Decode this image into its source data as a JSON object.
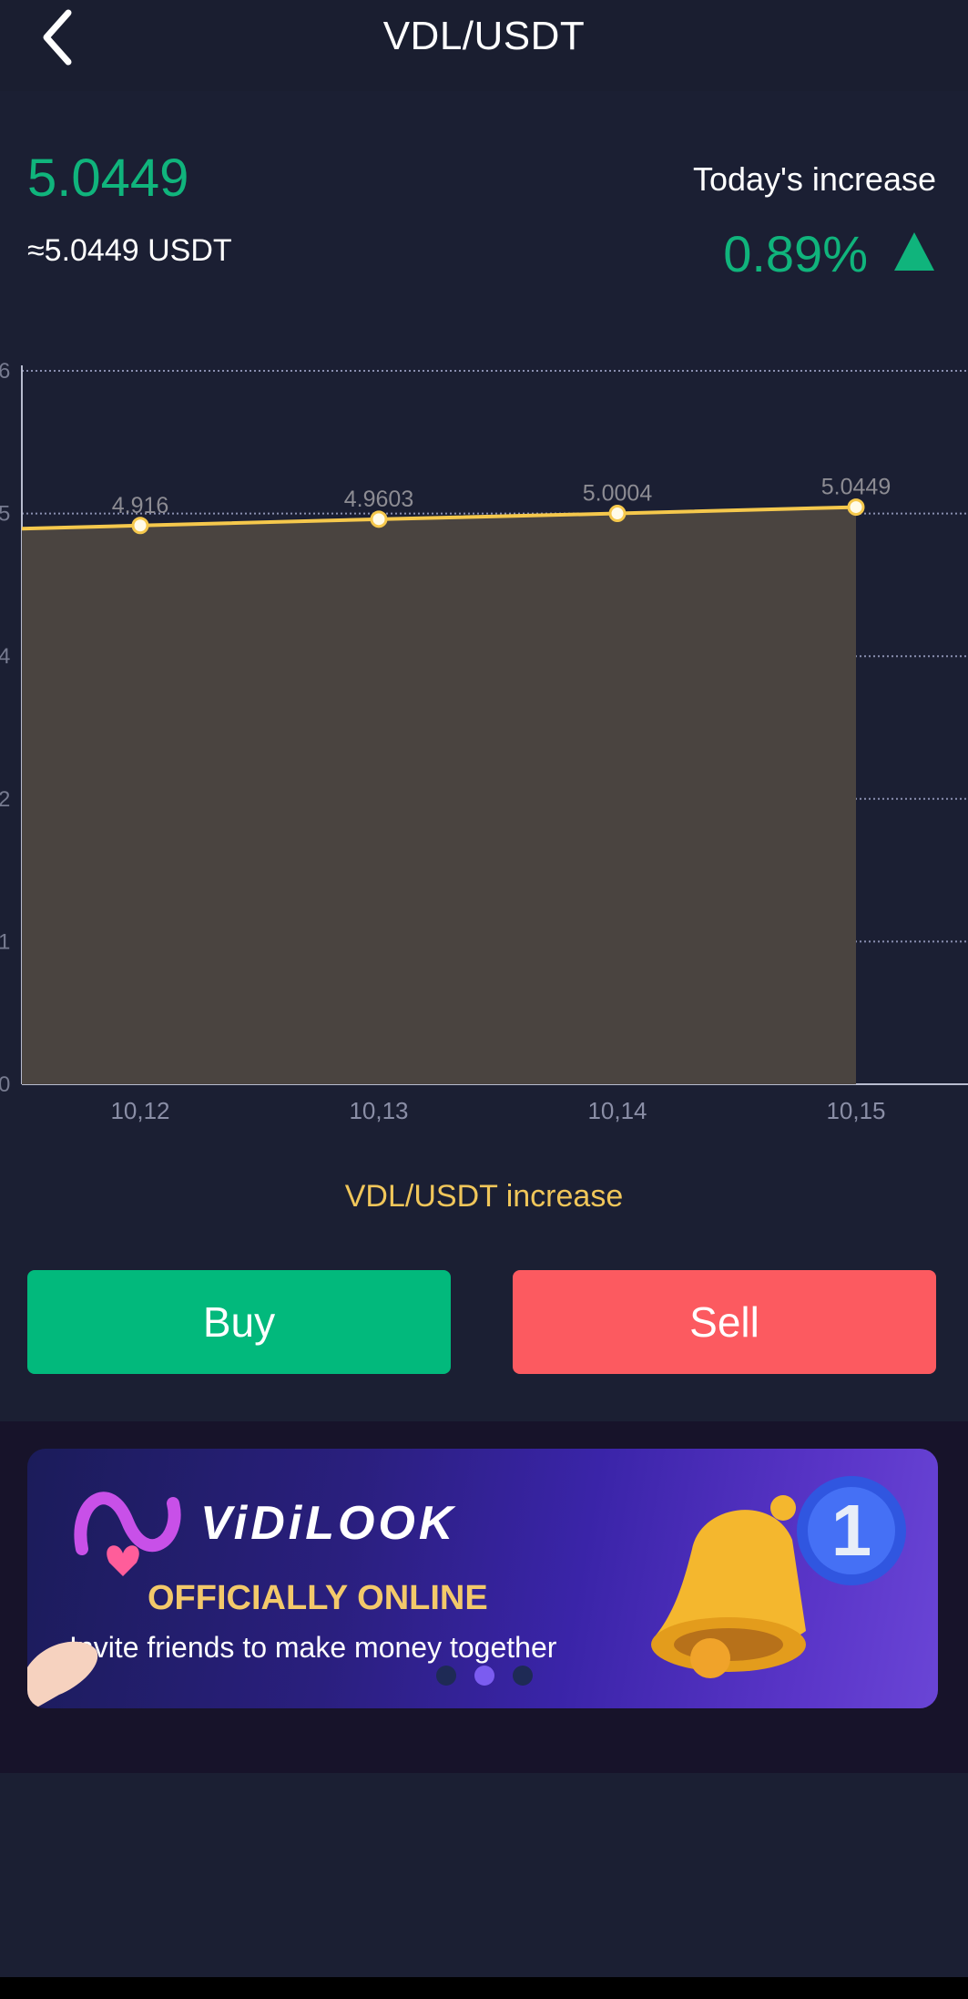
{
  "header": {
    "title": "VDL/USDT"
  },
  "price": {
    "main": "5.0449",
    "usdt": "≈5.0449 USDT"
  },
  "increase": {
    "label": "Today's increase",
    "value": "0.89%"
  },
  "chart_data": {
    "type": "line",
    "categories": [
      "10,12",
      "10,13",
      "10,14",
      "10,15"
    ],
    "series": [
      {
        "values": [
          4.916,
          4.9603,
          5.0004,
          5.0449
        ]
      }
    ],
    "data_labels": [
      "4.916",
      "4.9603",
      "5.0004",
      "5.0449"
    ],
    "y_tick_labels": [
      "0",
      "1",
      "2",
      "4",
      "5",
      "6"
    ],
    "grid": true,
    "area_fill": true,
    "line_color": "#f5c84c",
    "fill_color": "#4a4440"
  },
  "chart_caption": "VDL/USDT increase",
  "actions": {
    "buy_label": "Buy",
    "sell_label": "Sell"
  },
  "banner": {
    "brand": "ViDiLOOK",
    "headline": "OFFICIALLY ONLINE",
    "sub": "Invite friends to make money together",
    "slides": 3,
    "active_slide": 2
  },
  "colors": {
    "up": "#10b47c",
    "buy": "#02b97c",
    "sell": "#fc5a60",
    "accent": "#f0c65a"
  }
}
